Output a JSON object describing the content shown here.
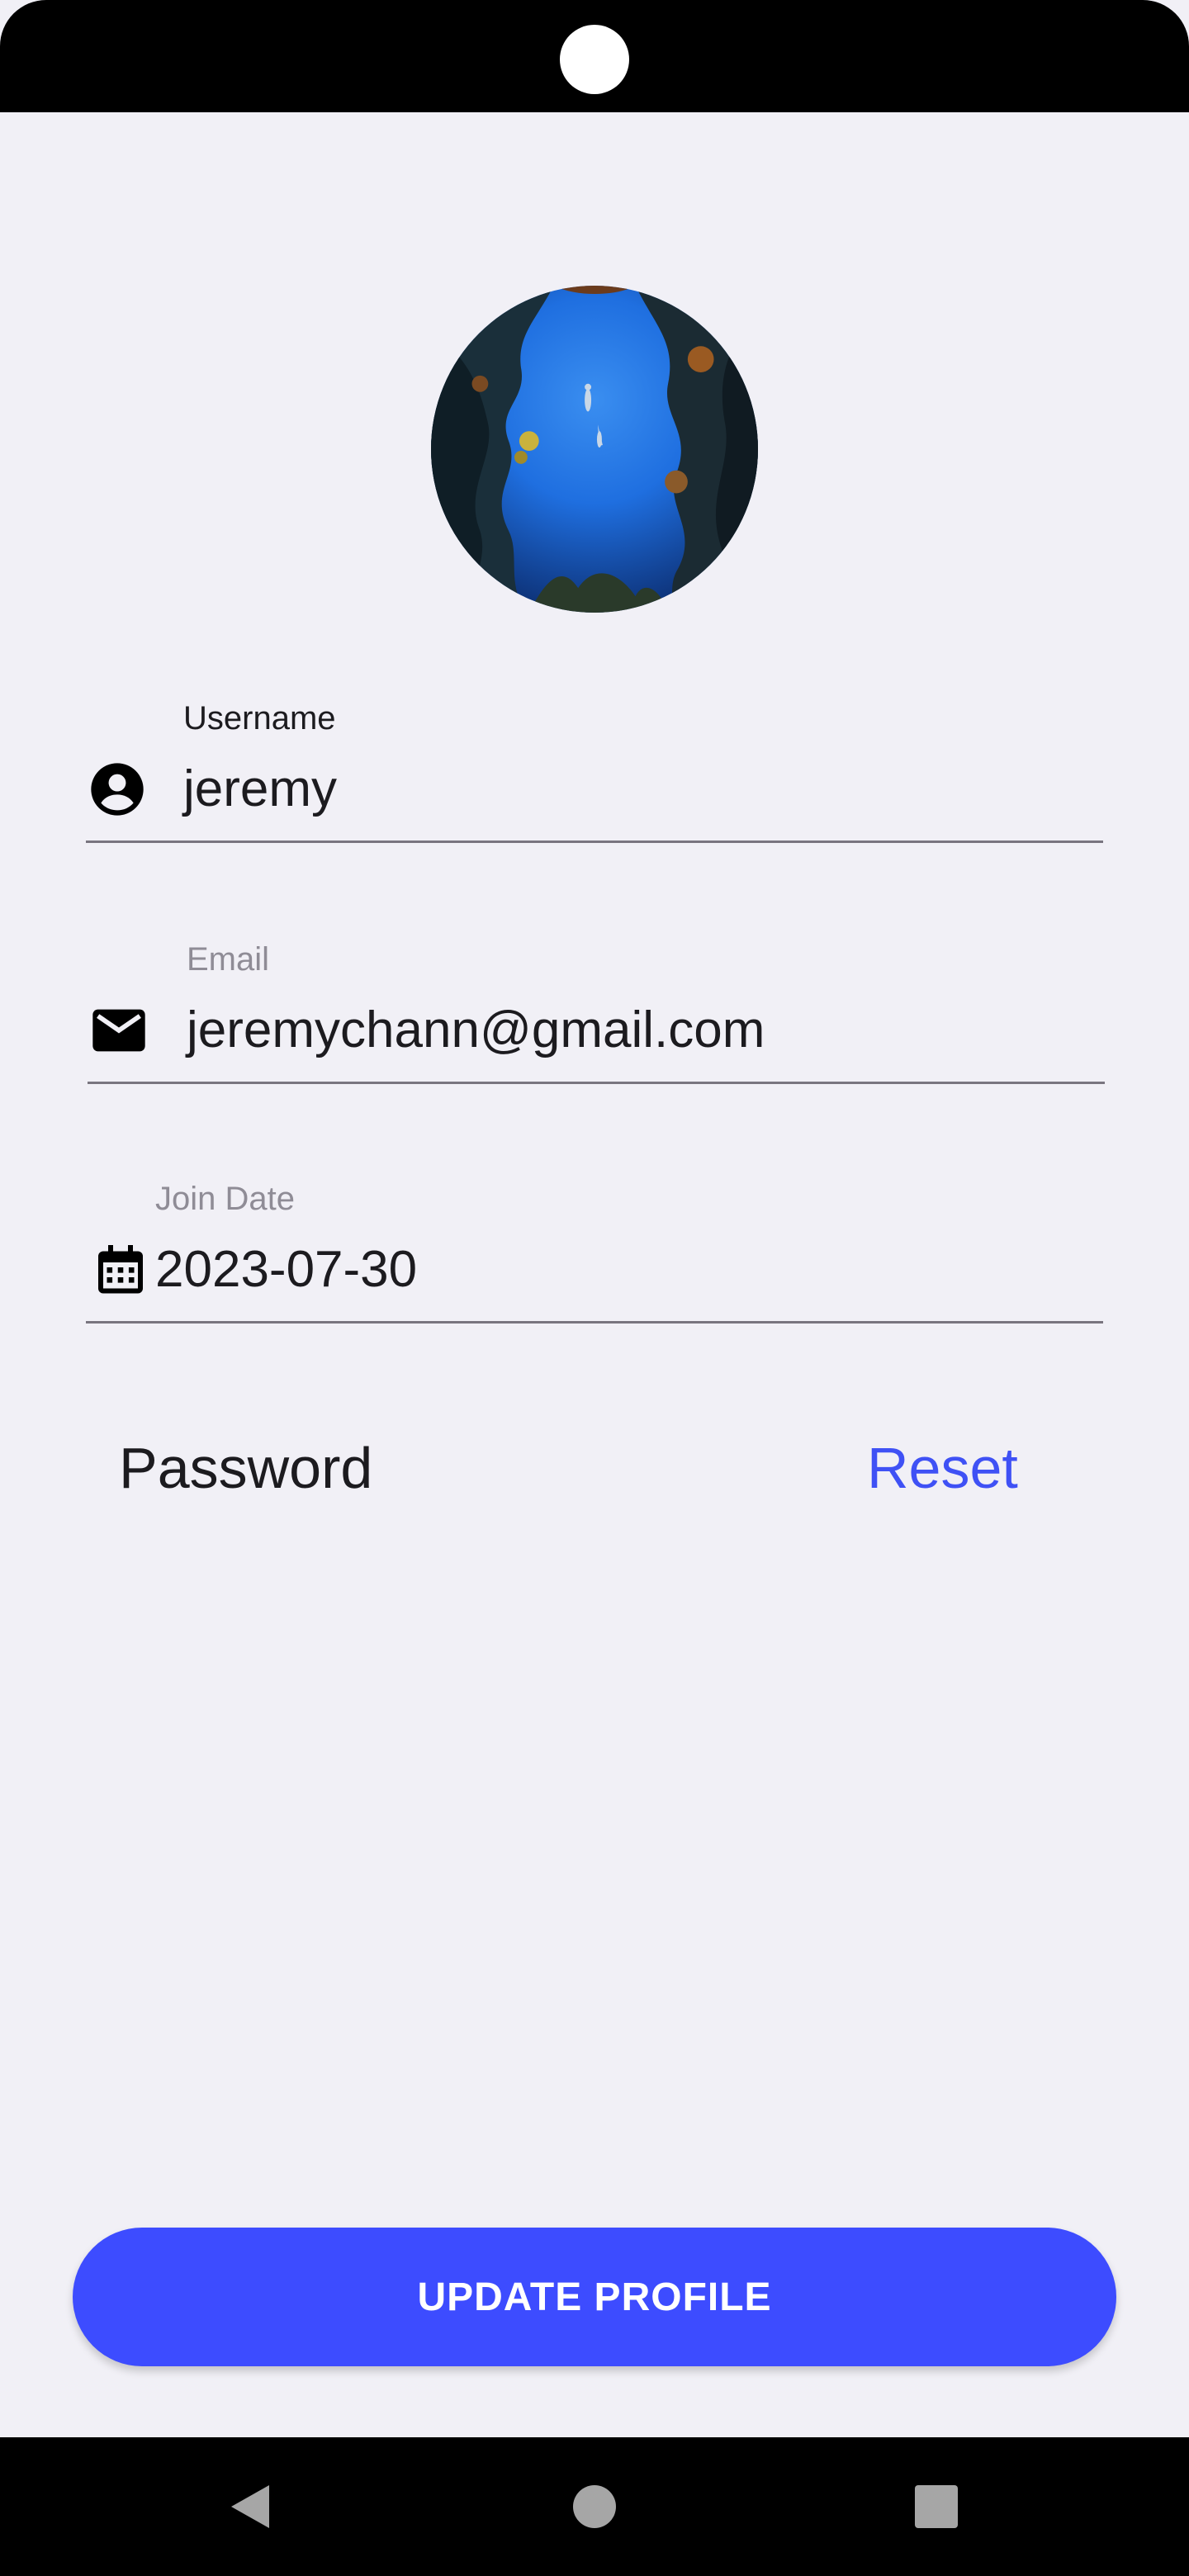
{
  "profile": {
    "avatar_icon": "profile-photo-underwater-diver"
  },
  "fields": {
    "username": {
      "label": "Username",
      "value": "jeremy",
      "icon": "account-circle-icon"
    },
    "email": {
      "label": "Email",
      "value": "jeremychann@gmail.com",
      "icon": "mail-icon"
    },
    "join_date": {
      "label": "Join Date",
      "value": "2023-07-30",
      "icon": "calendar-icon"
    }
  },
  "password": {
    "label": "Password",
    "reset_label": "Reset"
  },
  "actions": {
    "update_label": "UPDATE PROFILE"
  },
  "navigation": {
    "back_icon": "back-triangle-icon",
    "home_icon": "home-circle-icon",
    "recents_icon": "recents-square-icon"
  },
  "colors": {
    "background": "#f1f0f6",
    "accent": "#3d4cff",
    "link": "#3f51f5"
  }
}
